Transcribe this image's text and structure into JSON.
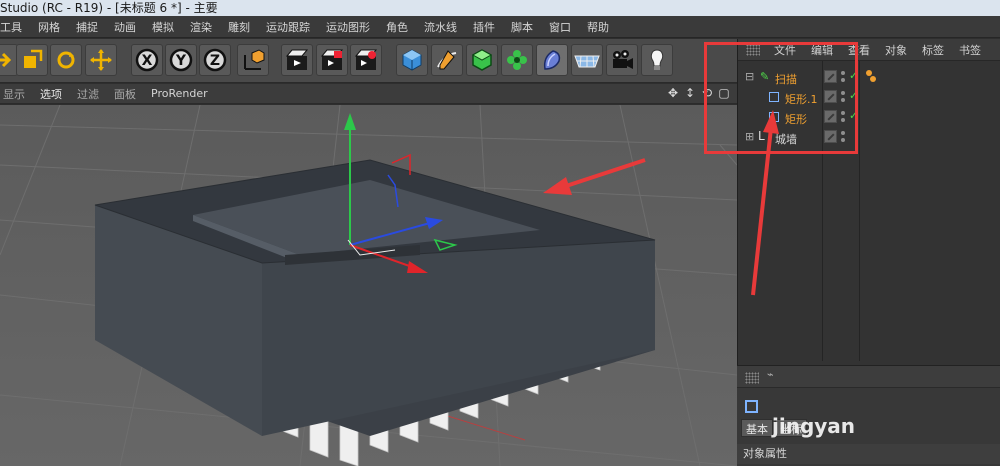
{
  "window": {
    "title": "Studio (RC - R19) - [未标题 6 *] - 主要"
  },
  "menu": [
    "工具",
    "网格",
    "捕捉",
    "动画",
    "模拟",
    "渲染",
    "雕刻",
    "运动跟踪",
    "运动图形",
    "角色",
    "流水线",
    "插件",
    "脚本",
    "窗口",
    "帮助"
  ],
  "toolbar": {
    "icons": [
      "move-arrow-icon",
      "scale-icon",
      "rotate-icon",
      "move-icon",
      "x-axis-icon",
      "y-axis-icon",
      "z-axis-icon",
      "coordinate-system-icon",
      "render-view-icon",
      "render-picture-viewer-icon",
      "render-settings-icon",
      "cube-icon",
      "pen-spline-icon",
      "subdivision-icon",
      "cloner-icon",
      "deformer-icon",
      "floor-icon",
      "camera-icon",
      "light-icon"
    ],
    "axis_labels": [
      "X",
      "Y",
      "Z"
    ]
  },
  "viewport_menu": {
    "items": [
      "显示",
      "选项",
      "过滤",
      "面板"
    ],
    "renderer": "ProRender"
  },
  "object_manager": {
    "tabs": [
      "文件",
      "编辑",
      "查看",
      "对象",
      "标签",
      "书签"
    ],
    "objects": [
      {
        "name": "扫描",
        "color": "#f0a030",
        "depth": 0
      },
      {
        "name": "矩形.1",
        "color": "#f0a030",
        "depth": 1
      },
      {
        "name": "矩形",
        "color": "#f0a030",
        "depth": 1
      },
      {
        "name": "城墙",
        "color": "#d8d8d8",
        "depth": 0
      }
    ]
  },
  "attributes": {
    "tabs": [
      "基本",
      "坐标"
    ],
    "footer": "对象属性"
  },
  "watermark": "jingyan",
  "colors": {
    "highlight_box": "#e83a3a",
    "axis_x": "#e0242a",
    "axis_y": "#2cc84a",
    "axis_z": "#2a4be0",
    "object_active": "#f0a030"
  }
}
